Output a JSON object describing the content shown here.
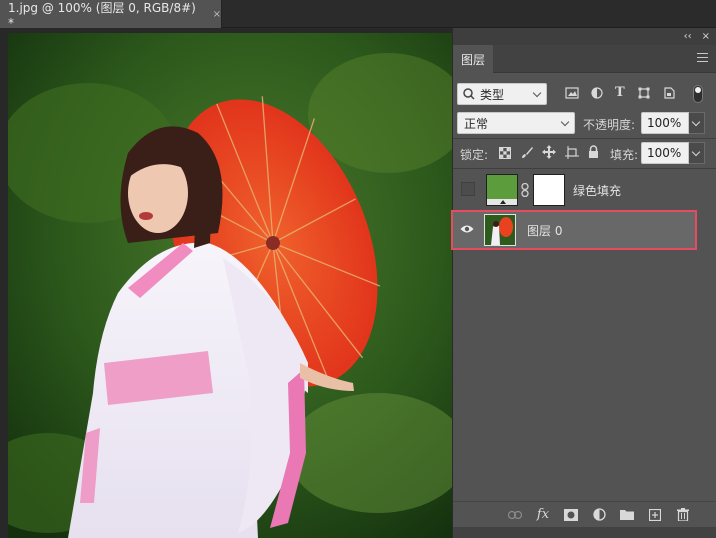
{
  "document": {
    "tab_title": "1.jpg @ 100% (图层 0, RGB/8#) *",
    "close_glyph": "×"
  },
  "panel": {
    "collapse_glyph": "‹‹",
    "close_glyph": "×",
    "tab_label": "图层",
    "filter": {
      "label": "类型",
      "icons": [
        "image-filter-icon",
        "adjustment-filter-icon",
        "type-filter-icon",
        "shape-filter-icon",
        "smart-object-filter-icon"
      ]
    },
    "blend_mode": "正常",
    "opacity_label": "不透明度:",
    "opacity_value": "100%",
    "lock_label": "锁定:",
    "fill_label": "填充:",
    "fill_value": "100%",
    "layers": [
      {
        "name": "绿色填充",
        "visible": false,
        "type": "fill",
        "fill_color": "#5c9c3c",
        "selected": false
      },
      {
        "name": "图层 0",
        "visible": true,
        "type": "pixel",
        "selected": true
      }
    ],
    "bottom_icons": [
      "link-icon",
      "fx-icon",
      "mask-icon",
      "adjustment-icon",
      "folder-icon",
      "new-layer-icon",
      "trash-icon"
    ],
    "fx_label": "fx"
  },
  "colors": {
    "panel_bg": "#535353",
    "selected_layer_outline": "#e84a5f",
    "selected_layer_bg": "#686868"
  }
}
